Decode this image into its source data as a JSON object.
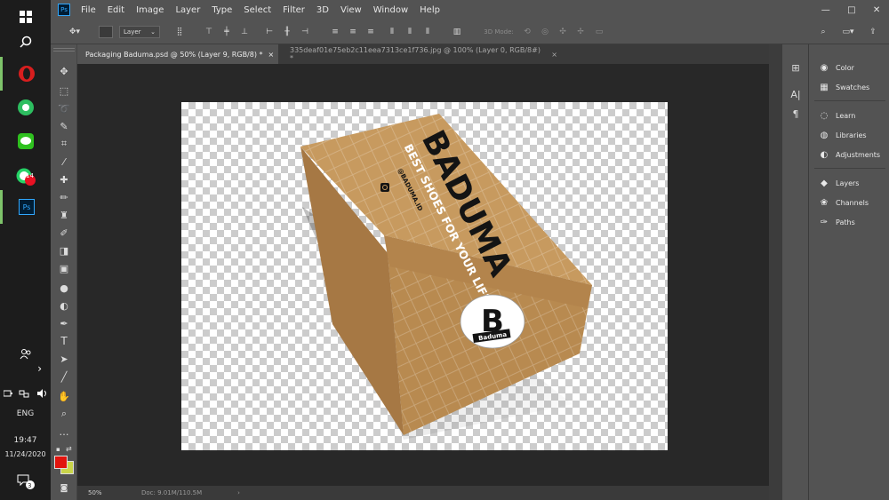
{
  "taskbar": {
    "time": "19:47",
    "date": "11/24/2020",
    "language": "ENG",
    "whatsapp_badge": "14",
    "notification_count": "3",
    "ps_label": "Ps"
  },
  "app": {
    "logo": "Ps",
    "menus": [
      "File",
      "Edit",
      "Image",
      "Layer",
      "Type",
      "Select",
      "Filter",
      "3D",
      "View",
      "Window",
      "Help"
    ]
  },
  "options": {
    "auto_select_value": "Layer",
    "mode_3d_label": "3D Mode:"
  },
  "tabs": [
    {
      "label": "Packaging Baduma.psd @ 50% (Layer 9, RGB/8) *",
      "close": "×"
    },
    {
      "label": "335deaf01e75eb2c11eea7313ce1f736.jpg @ 100% (Layer 0, RGB/8#) *",
      "close": "×"
    }
  ],
  "status": {
    "zoom": "50%",
    "doc": "Doc: 9.01M/110.5M"
  },
  "panels": {
    "group1": [
      "Color",
      "Swatches"
    ],
    "group2": [
      "Learn",
      "Libraries",
      "Adjustments"
    ],
    "group3": [
      "Layers",
      "Channels",
      "Paths"
    ]
  },
  "artwork": {
    "brand": "BADUMA",
    "tagline": "BEST SHOES FOR YOUR LIFESTYLE",
    "handle": "@BADUMA.ID",
    "logo_letter": "B",
    "logo_word": "Baduma"
  },
  "colors": {
    "foreground": "#e2140e",
    "background": "#c9d54a",
    "box_top": "#c79a5f",
    "box_front": "#b88a50",
    "box_side": "#a67844"
  }
}
